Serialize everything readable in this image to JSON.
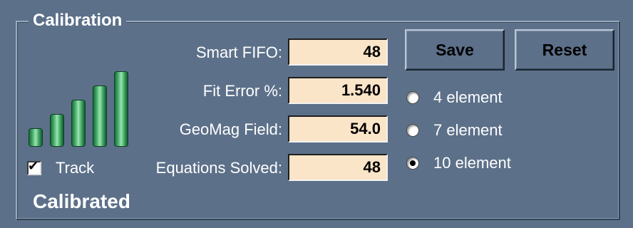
{
  "group": {
    "title": "Calibration"
  },
  "signal_bars": {
    "level": 5,
    "max": 5,
    "icon": "signal-strength-icon",
    "color": "#3fa463"
  },
  "fields": [
    {
      "label": "Smart FIFO:",
      "value": "48"
    },
    {
      "label": "Fit Error %:",
      "value": "1.540"
    },
    {
      "label": "GeoMag Field:",
      "value": "54.0"
    },
    {
      "label": "Equations Solved:",
      "value": "48"
    }
  ],
  "buttons": {
    "save": "Save",
    "reset": "Reset"
  },
  "radios": [
    {
      "label": "4 element",
      "selected": false
    },
    {
      "label": "7 element",
      "selected": false
    },
    {
      "label": "10 element",
      "selected": true
    }
  ],
  "track": {
    "label": "Track",
    "checked": true
  },
  "status": "Calibrated"
}
